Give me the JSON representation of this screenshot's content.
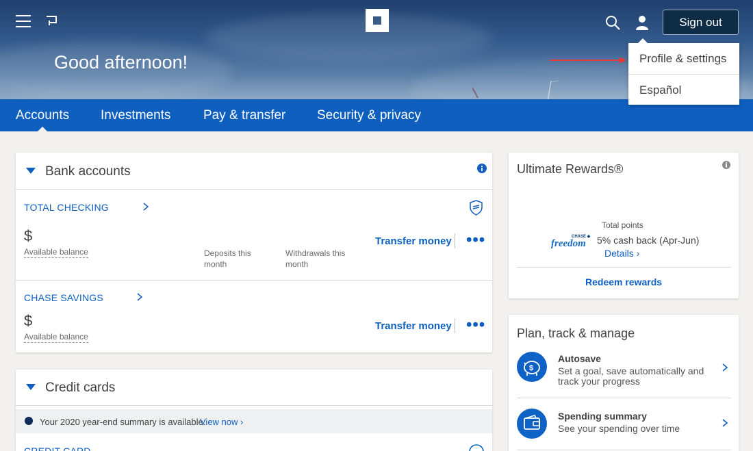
{
  "header": {
    "greeting": "Good afternoon!",
    "sign_out_label": "Sign out",
    "icons": [
      "menu-icon",
      "flag-icon",
      "chase-logo",
      "search-icon",
      "profile-icon"
    ]
  },
  "profile_menu": {
    "items": [
      "Profile & settings",
      "Español"
    ]
  },
  "nav": {
    "tabs": [
      "Accounts",
      "Investments",
      "Pay & transfer",
      "Security & privacy"
    ],
    "active": "Accounts"
  },
  "bank_accounts": {
    "title": "Bank accounts",
    "accounts": [
      {
        "name": "TOTAL CHECKING",
        "balance": "$",
        "balance_label": "Available balance",
        "deposits_label": "Deposits this month",
        "withdrawals_label": "Withdrawals this month",
        "action": "Transfer money"
      },
      {
        "name": "CHASE SAVINGS",
        "balance": "$",
        "balance_label": "Available balance",
        "action": "Transfer money"
      }
    ]
  },
  "credit_cards": {
    "title": "Credit cards",
    "summary_text": "Your 2020 year-end summary is available.",
    "summary_link": "View now",
    "first_card": "CREDIT CARD"
  },
  "rewards": {
    "title": "Ultimate Rewards®",
    "total_points_label": "Total points",
    "offer": "5% cash back (Apr-Jun)",
    "details_link": "Details",
    "redeem_link": "Redeem rewards"
  },
  "plan": {
    "title": "Plan, track & manage",
    "items": [
      {
        "title": "Autosave",
        "desc": "Set a goal, save automatically and track your progress"
      },
      {
        "title": "Spending summary",
        "desc": "See your spending over time"
      }
    ]
  },
  "colors": {
    "nav_blue": "#0f5fbf",
    "link_blue": "#0e5fc0",
    "signout_bg": "#0e2c45",
    "annotation_red": "#e53935"
  }
}
